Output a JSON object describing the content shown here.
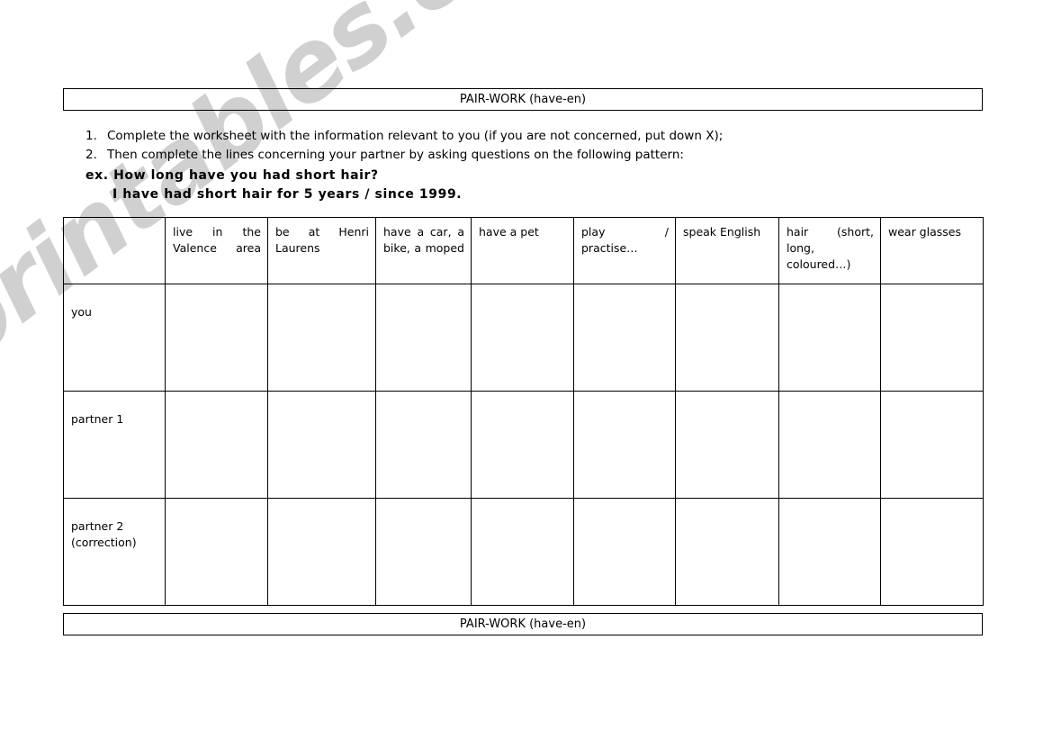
{
  "document": {
    "header_title": "PAIR-WORK (have-en)",
    "footer_title": "PAIR-WORK (have-en)"
  },
  "watermark": {
    "text": "ESLprintables.com",
    "color": "#d0d0d0"
  },
  "instructions": {
    "items": [
      {
        "number": "1.",
        "text": "Complete the worksheet with the information relevant to you (if you are not concerned, put down X);"
      },
      {
        "number": "2.",
        "text": "Then complete the lines concerning your partner by asking questions on the following pattern:"
      }
    ],
    "example_line_1": "ex. How long have you had short hair?",
    "example_line_2": "I have had short hair for 5 years / since 1999."
  },
  "table": {
    "corner_label": "",
    "columns": [
      "live in the Valence area",
      "be at Henri Laurens",
      "have a car, a bike, a moped",
      "have a pet",
      "play / practise…",
      "speak English",
      "hair (short, long, coloured…)",
      "wear glasses"
    ],
    "rows": [
      {
        "label_line_1": "you",
        "label_line_2": ""
      },
      {
        "label_line_1": "partner 1",
        "label_line_2": ""
      },
      {
        "label_line_1": "partner 2",
        "label_line_2": "(correction)"
      }
    ],
    "cell_values": [
      [
        "",
        "",
        "",
        "",
        "",
        "",
        "",
        ""
      ],
      [
        "",
        "",
        "",
        "",
        "",
        "",
        "",
        ""
      ],
      [
        "",
        "",
        "",
        "",
        "",
        "",
        "",
        ""
      ]
    ]
  }
}
